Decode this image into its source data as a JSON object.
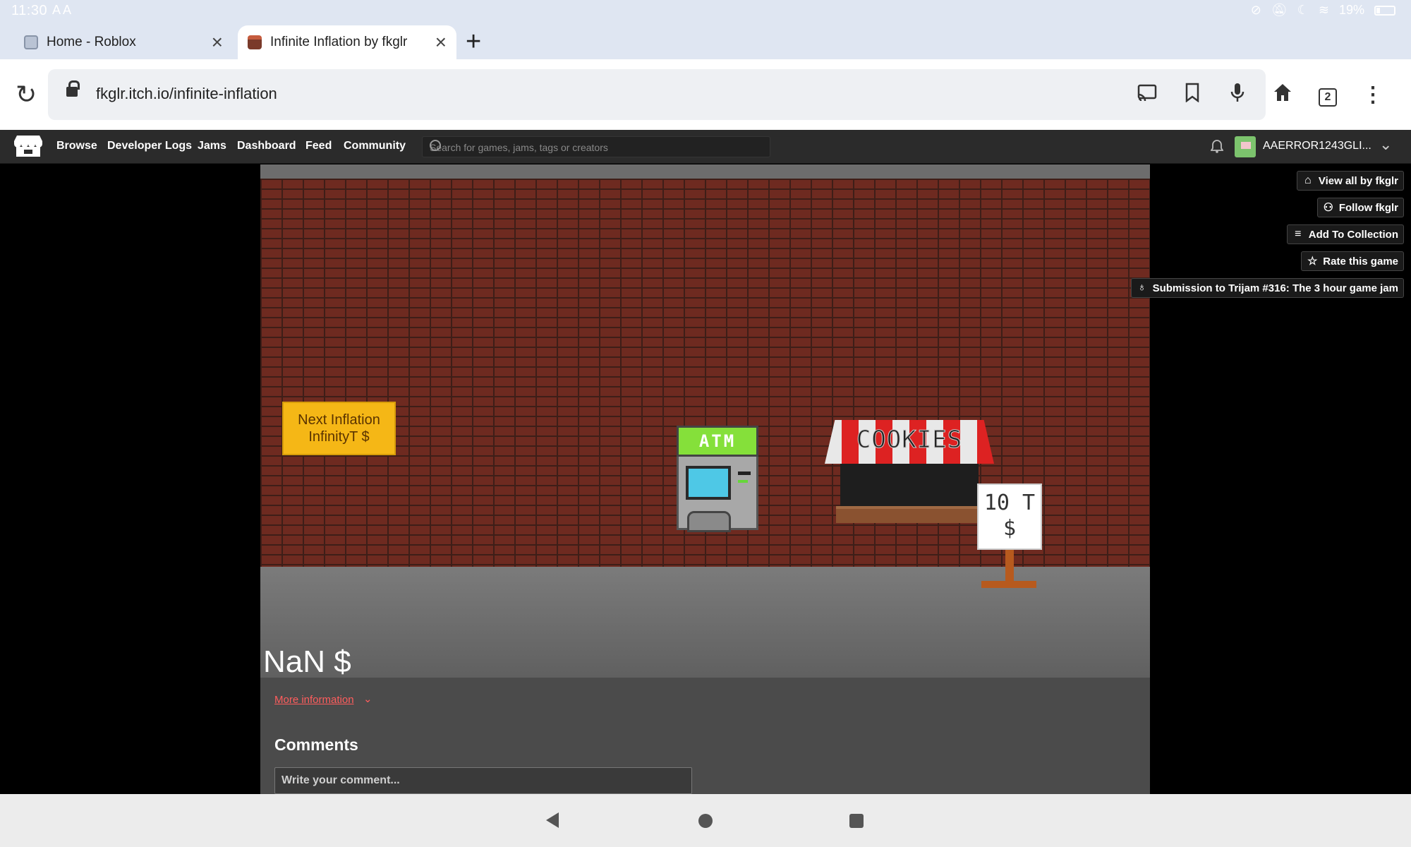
{
  "status_bar": {
    "time": "11:30",
    "left_icons": "A  A",
    "battery": "19%"
  },
  "tabs": [
    {
      "title": "Home - Roblox",
      "active": false
    },
    {
      "title": "Infinite Inflation by fkglr",
      "active": true
    }
  ],
  "address_bar": {
    "url": "fkglr.itch.io/infinite-inflation",
    "tab_count": "2"
  },
  "itch_nav": {
    "links": [
      "Browse",
      "Developer Logs",
      "Jams",
      "Dashboard",
      "Feed",
      "Community"
    ],
    "search_placeholder": "Search for games, jams, tags or creators",
    "username": "AAERROR1243GLI..."
  },
  "game": {
    "next_inflation_label": "Next Inflation",
    "next_inflation_value": "InfinityT $",
    "atm_label": "ATM",
    "stall_label": "COOKIES",
    "price_line1": "10 T",
    "price_line2": "$",
    "money": "NaN $"
  },
  "side_actions": [
    {
      "label": "View all by fkglr",
      "icon": "store-icon"
    },
    {
      "label": "Follow fkglr",
      "icon": "follow-icon"
    },
    {
      "label": "Add To Collection",
      "icon": "collection-icon"
    },
    {
      "label": "Rate this game",
      "icon": "star-icon"
    },
    {
      "label": "Submission to Trijam #316: The 3 hour game jam",
      "icon": "ribbon-icon"
    }
  ],
  "page": {
    "more_information": "More information",
    "comments_heading": "Comments",
    "comment_placeholder": "Write your comment..."
  },
  "colors": {
    "itch_nav_bg": "#2b2b2b",
    "link_red": "#ff5d5d",
    "inflation_box": "#f5b716"
  }
}
